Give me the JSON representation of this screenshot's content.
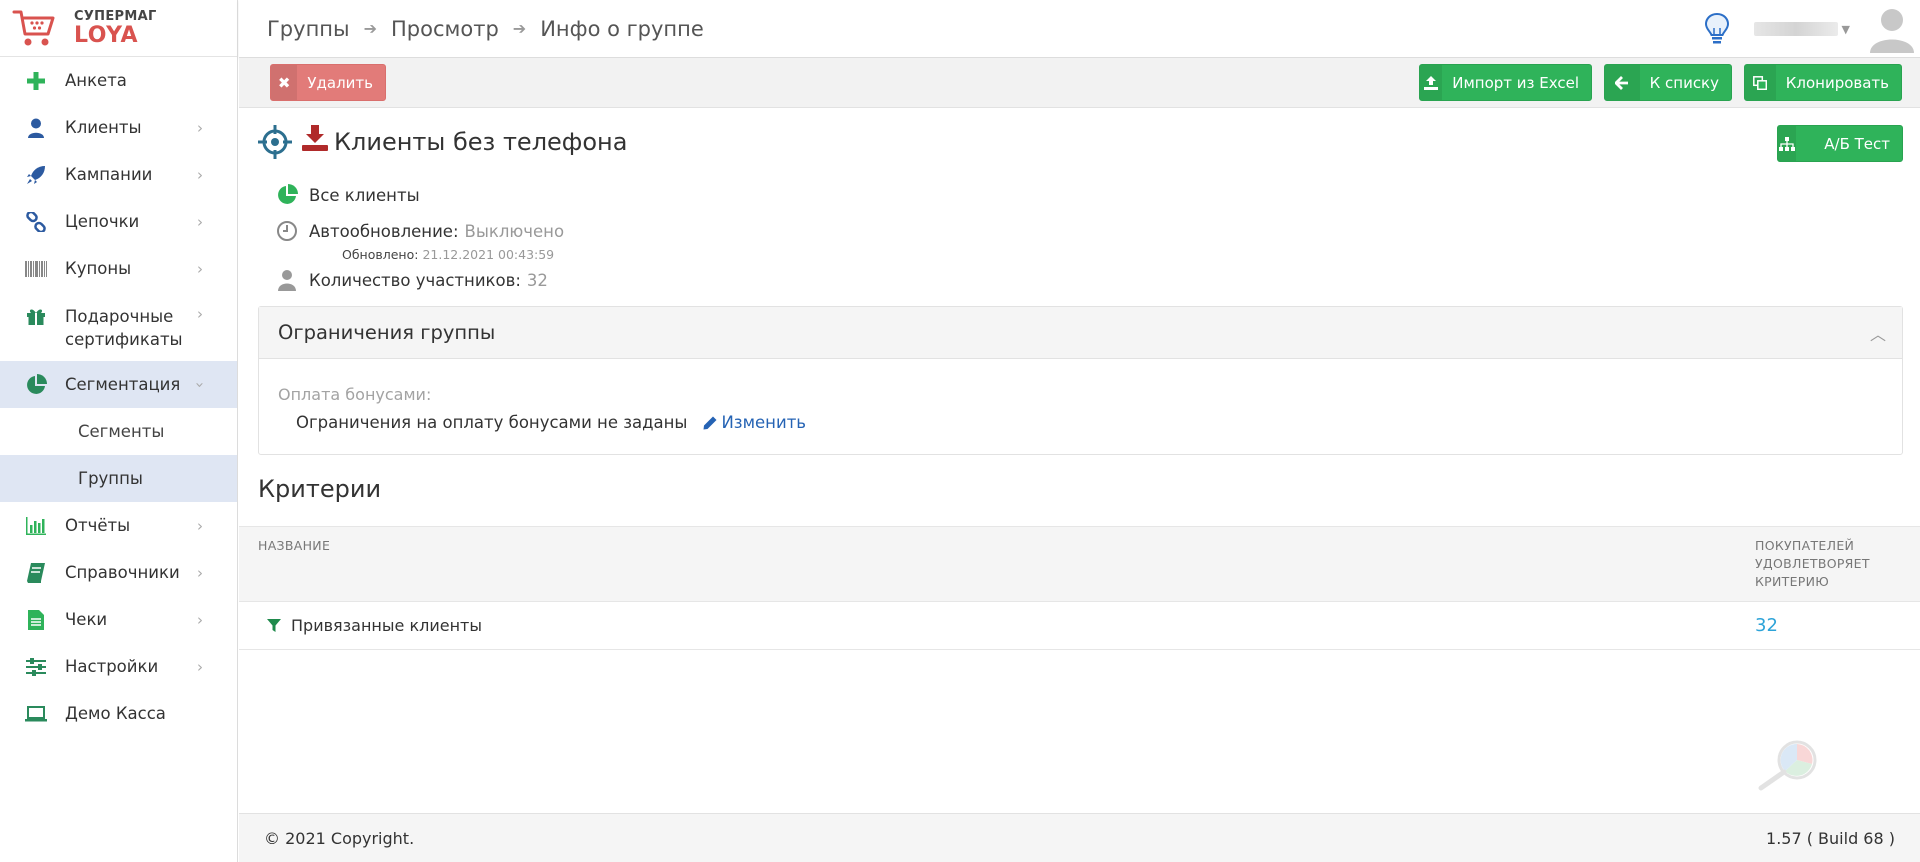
{
  "brand": {
    "top": "СУПЕРМАГ",
    "bottom": "LOYA"
  },
  "sidebar": {
    "items": [
      {
        "label": "Анкета"
      },
      {
        "label": "Клиенты"
      },
      {
        "label": "Кампании"
      },
      {
        "label": "Цепочки"
      },
      {
        "label": "Купоны"
      },
      {
        "label": "Подарочные сертификаты"
      },
      {
        "label": "Сегментация",
        "active": true
      },
      {
        "label": "Отчёты"
      },
      {
        "label": "Справочники"
      },
      {
        "label": "Чеки"
      },
      {
        "label": "Настройки"
      },
      {
        "label": "Демо Касса"
      }
    ],
    "sub_items": [
      {
        "label": "Сегменты"
      },
      {
        "label": "Группы",
        "active": true
      }
    ]
  },
  "breadcrumb": [
    "Группы",
    "Просмотр",
    "Инфо о группе"
  ],
  "toolbar": {
    "delete_label": "Удалить",
    "import_label": "Импорт из Excel",
    "list_label": "К списку",
    "clone_label": "Клонировать",
    "ab_label": "А/Б Тест"
  },
  "group": {
    "title": "Клиенты без телефона",
    "all_clients": "Все клиенты",
    "autoupdate_label": "Автообновление:",
    "autoupdate_value": "Выключено",
    "updated_label": "Обновлено:",
    "updated_value": "21.12.2021 00:43:59",
    "count_label": "Количество участников:",
    "count_value": "32"
  },
  "restrictions": {
    "title": "Ограничения группы",
    "bonus_label": "Оплата бонусами:",
    "bonus_value": "Ограничения на оплату бонусами не заданы",
    "edit_label": "Изменить"
  },
  "criteria": {
    "title": "Критерии",
    "columns": [
      "Название",
      "Покупателей удовлетворяет критерию"
    ],
    "rows": [
      {
        "name": "Привязанные клиенты",
        "count": "32"
      }
    ]
  },
  "footer": {
    "copyright": "© 2021 Copyright.",
    "version": "1.57 ( Build 68 )"
  },
  "colors": {
    "success": "#2fb35a",
    "danger": "#e27b79",
    "active_nav": "#dfe6f3",
    "link": "#2563b4",
    "count_link": "#2da3d8",
    "brand_red": "#d9534f"
  },
  "icons": {
    "nav": [
      "plus-icon",
      "user-icon",
      "rocket-icon",
      "chain-icon",
      "barcode-icon",
      "gift-icon",
      "pie-chart-icon",
      "bar-chart-icon",
      "book-icon",
      "receipt-icon",
      "sliders-icon",
      "laptop-icon"
    ]
  }
}
